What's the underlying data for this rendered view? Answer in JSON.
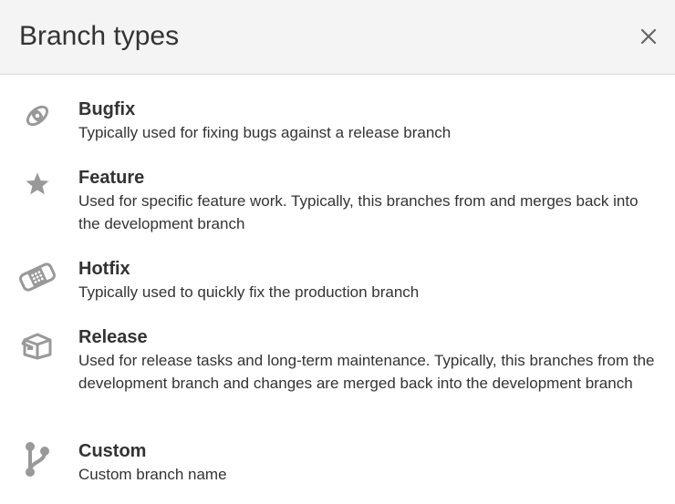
{
  "dialog": {
    "title": "Branch types",
    "close_label": "×",
    "colors": {
      "header_bg": "#f4f4f4",
      "text": "#333333",
      "icon": "#999999"
    }
  },
  "branch_types": [
    {
      "icon": "bug-icon",
      "name": "Bugfix",
      "description": "Typically used for fixing bugs against a release branch"
    },
    {
      "icon": "star-icon",
      "name": "Feature",
      "description": "Used for specific feature work. Typically, this branches from and merges back into the development branch"
    },
    {
      "icon": "bandage-icon",
      "name": "Hotfix",
      "description": "Typically used to quickly fix the production branch"
    },
    {
      "icon": "box-icon",
      "name": "Release",
      "description": "Used for release tasks and long-term maintenance. Typically, this branches from the development branch and changes are merged back into the development branch"
    },
    {
      "icon": "branch-icon",
      "name": "Custom",
      "description": "Custom branch name"
    }
  ]
}
